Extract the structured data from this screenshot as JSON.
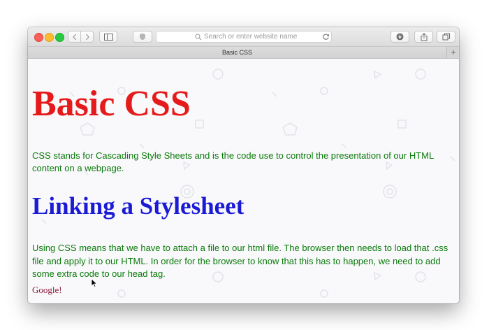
{
  "browser": {
    "address_placeholder": "Search or enter website name",
    "tab_title": "Basic CSS",
    "new_tab_label": "+"
  },
  "page": {
    "heading": "Basic CSS",
    "intro": "CSS stands for Cascading Style Sheets and is the code use to control the presentation of our HTML content on a webpage.",
    "subheading": "Linking a Stylesheet",
    "body": "Using CSS means that we have to attach a file to our html file. The browser then needs to load that .css file and apply it to our HTML. In order for the browser to know that this has to happen, we need to add some extra code to our head tag.",
    "link_text": "Google!"
  },
  "colors": {
    "heading": "#e51b1b",
    "subheading": "#1b1bd6",
    "paragraph": "#0a7a0a",
    "link": "#8b1a3a"
  }
}
